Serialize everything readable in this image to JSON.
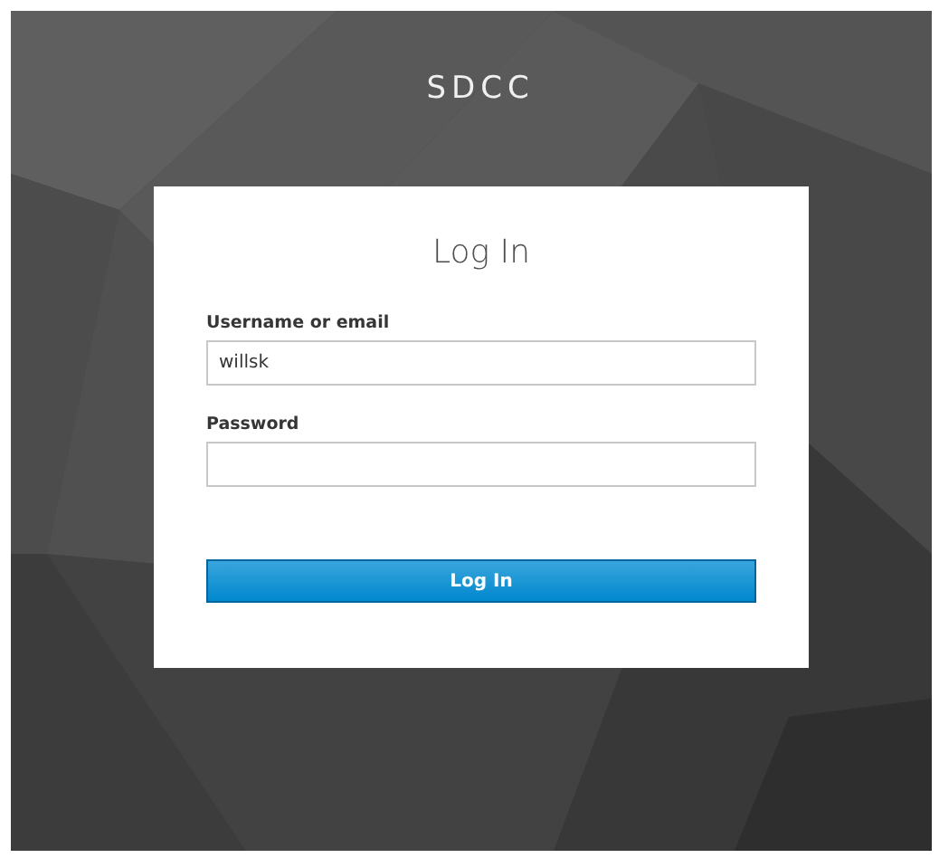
{
  "header": {
    "title": "SDCC"
  },
  "login_card": {
    "title": "Log In",
    "fields": [
      {
        "label": "Username or email",
        "value": "willsk"
      },
      {
        "label": "Password"
      }
    ],
    "button": "Log In"
  }
}
